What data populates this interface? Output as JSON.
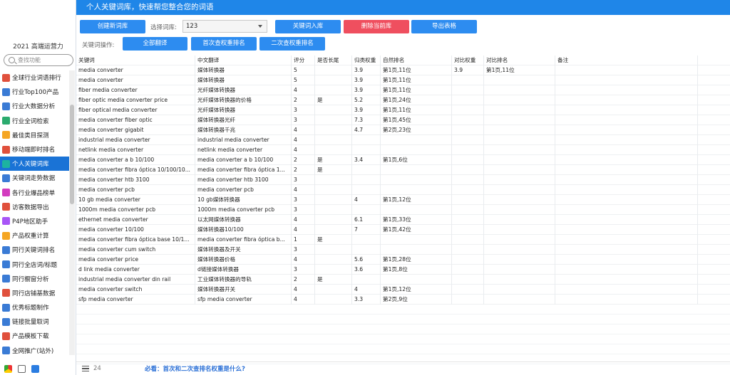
{
  "app_title": "2021 高端运营力",
  "search_placeholder": "查找功能",
  "header_title": "个人关键词库，快速帮您整合您的词语",
  "toolbar": {
    "create_label": "创建新词库",
    "select_label": "选择词库:",
    "select_value": "123",
    "import_label": "关键词入库",
    "delete_label": "删除当前库",
    "export_label": "导出表格",
    "ops_label": "关键词操作:",
    "translate_label": "全部翻译",
    "first_rank_label": "首次查权重排名",
    "second_rank_label": "二次查权重排名"
  },
  "menu": [
    {
      "label": "全球行业词语排行",
      "color": "#e0503c"
    },
    {
      "label": "行业Top100产品",
      "color": "#3a7bd5"
    },
    {
      "label": "行业大数据分析",
      "color": "#3a7bd5"
    },
    {
      "label": "行业全词检索",
      "color": "#2bab6e"
    },
    {
      "label": "最佳类目探测",
      "color": "#f5a623"
    },
    {
      "label": "移动端即时排名",
      "color": "#e0503c"
    },
    {
      "label": "个人关键词库",
      "color": "#1db3a0"
    },
    {
      "label": "关键词走势数据",
      "color": "#3a7bd5"
    },
    {
      "label": "各行业爆品榜单",
      "color": "#d33cbf"
    },
    {
      "label": "访客数据导出",
      "color": "#e0503c"
    },
    {
      "label": "P4P地区助手",
      "color": "#a855f7"
    },
    {
      "label": "产品权重计算",
      "color": "#f5a623"
    },
    {
      "label": "同行关键词排名",
      "color": "#3a7bd5"
    },
    {
      "label": "同行全店词/标题",
      "color": "#3a7bd5"
    },
    {
      "label": "同行橱窗分析",
      "color": "#3a7bd5"
    },
    {
      "label": "同行店铺基数据",
      "color": "#e0503c"
    },
    {
      "label": "优秀标题制作",
      "color": "#3a7bd5"
    },
    {
      "label": "链接批量取词",
      "color": "#3a7bd5"
    },
    {
      "label": "产品模板下载",
      "color": "#e0503c"
    },
    {
      "label": "全网推广(站外)",
      "color": "#3a7bd5"
    }
  ],
  "active_menu_index": 6,
  "table": {
    "headers": [
      "关键词",
      "中文翻译",
      "评分",
      "是否长尾",
      "归类权重",
      "自然排名",
      "对比权重",
      "对比排名",
      "备注"
    ],
    "rows": [
      [
        "media converter",
        "媒体转换器",
        "5",
        "",
        "3.9",
        "第1页,11位",
        "3.9",
        "第1页,11位",
        ""
      ],
      [
        "media converter",
        "媒体转换器",
        "5",
        "",
        "3.9",
        "第1页,11位",
        "",
        "",
        ""
      ],
      [
        "fiber media converter",
        "光纤媒体转换器",
        "4",
        "",
        "3.9",
        "第1页,11位",
        "",
        "",
        ""
      ],
      [
        "fiber optic media converter price",
        "光纤媒体转换器的价格",
        "2",
        "是",
        "5.2",
        "第1页,24位",
        "",
        "",
        ""
      ],
      [
        "fiber optical media converter",
        "光纤媒体转换器",
        "3",
        "",
        "3.9",
        "第1页,11位",
        "",
        "",
        ""
      ],
      [
        "media converter fiber optic",
        "媒体转换器光纤",
        "3",
        "",
        "7.3",
        "第1页,45位",
        "",
        "",
        ""
      ],
      [
        "media converter gigabit",
        "媒体转换器千兆",
        "4",
        "",
        "4.7",
        "第2页,23位",
        "",
        "",
        ""
      ],
      [
        "industrial media converter",
        "industrial media converter",
        "4",
        "",
        "",
        "",
        "",
        "",
        ""
      ],
      [
        "netlink media converter",
        "netlink media converter",
        "4",
        "",
        "",
        "",
        "",
        "",
        ""
      ],
      [
        "media converter a b 10/100",
        "media converter a b 10/100",
        "2",
        "是",
        "3.4",
        "第1页,6位",
        "",
        "",
        ""
      ],
      [
        "media converter fibra óptica 10/100/10...",
        "media converter fibra óptica 1...",
        "2",
        "是",
        "",
        "",
        "",
        "",
        ""
      ],
      [
        "media converter htb 3100",
        "media converter htb 3100",
        "3",
        "",
        "",
        "",
        "",
        "",
        ""
      ],
      [
        "media converter pcb",
        "media converter pcb",
        "4",
        "",
        "",
        "",
        "",
        "",
        ""
      ],
      [
        "10 gb media converter",
        "10 gb媒体转换器",
        "3",
        "",
        "4",
        "第1页,12位",
        "",
        "",
        ""
      ],
      [
        "1000m media converter pcb",
        "1000m media converter pcb",
        "3",
        "",
        "",
        "",
        "",
        "",
        ""
      ],
      [
        "ethernet media converter",
        "以太网媒体转换器",
        "4",
        "",
        "6.1",
        "第1页,33位",
        "",
        "",
        ""
      ],
      [
        "media converter 10/100",
        "媒体转换器10/100",
        "4",
        "",
        "7",
        "第1页,42位",
        "",
        "",
        ""
      ],
      [
        "media converter fibra óptica base 10/1...",
        "media converter fibra óptica b...",
        "1",
        "是",
        "",
        "",
        "",
        "",
        ""
      ],
      [
        "media converter cum switch",
        "媒体转换器及开关",
        "3",
        "",
        "",
        "",
        "",
        "",
        ""
      ],
      [
        "media converter price",
        "媒体转换器价格",
        "4",
        "",
        "5.6",
        "第1页,28位",
        "",
        "",
        ""
      ],
      [
        "d link media converter",
        "d链接媒体转换器",
        "3",
        "",
        "3.6",
        "第1页,8位",
        "",
        "",
        ""
      ],
      [
        "industrial media converter din rail",
        "工业媒体转换器的导轨",
        "2",
        "是",
        "",
        "",
        "",
        "",
        ""
      ],
      [
        "media converter switch",
        "媒体转换器开关",
        "4",
        "",
        "4",
        "第1页,12位",
        "",
        "",
        ""
      ],
      [
        "sfp media converter",
        "sfp media converter",
        "4",
        "",
        "3.3",
        "第2页,9位",
        "",
        "",
        ""
      ]
    ]
  },
  "footer": {
    "count": "24",
    "faq": "必看：首次和二次查排名权重是什么?"
  }
}
